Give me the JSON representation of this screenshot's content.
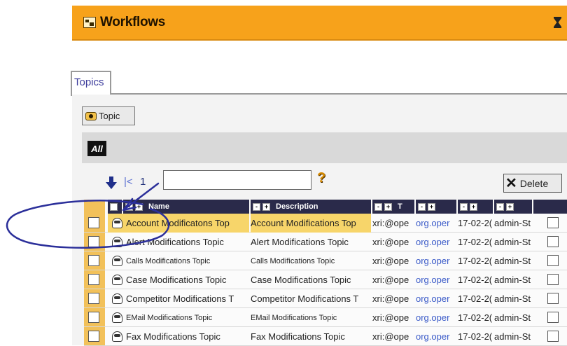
{
  "window": {
    "title": "Workflows",
    "icon": "workflow-icon",
    "status_icon": "hourglass-icon"
  },
  "tabs": [
    {
      "label": "Topics",
      "active": true
    }
  ],
  "toolbar": {
    "topic_button": "Topic",
    "all_button": "All",
    "delete_button": "Delete"
  },
  "pagination": {
    "current_page": "1",
    "input_value": ""
  },
  "columns": [
    {
      "label": "Name"
    },
    {
      "label": "Description"
    },
    {
      "label": "T"
    },
    {
      "label": ""
    },
    {
      "label": ""
    },
    {
      "label": ""
    }
  ],
  "rows": [
    {
      "name": "Account Modificatons Top",
      "description": "Account Modifications Top",
      "col3": "xri:@ope",
      "col4": "org.oper",
      "col5": "17-02-2(",
      "col6": "admin-St"
    },
    {
      "name": "Alert Modifications Topic",
      "description": "Alert Modifications Topic",
      "col3": "xri:@ope",
      "col4": "org.oper",
      "col5": "17-02-2(",
      "col6": "admin-St"
    },
    {
      "name": "Calls Modifications Topic",
      "description": "Calls Modifications Topic",
      "col3": "xri:@ope",
      "col4": "org.oper",
      "col5": "17-02-2(",
      "col6": "admin-St"
    },
    {
      "name": "Case Modifications Topic",
      "description": "Case Modifications Topic",
      "col3": "xri:@ope",
      "col4": "org.oper",
      "col5": "17-02-2(",
      "col6": "admin-St"
    },
    {
      "name": "Competitor Modifications T",
      "description": "Competitor Modifications T",
      "col3": "xri:@ope",
      "col4": "org.oper",
      "col5": "17-02-2(",
      "col6": "admin-St"
    },
    {
      "name": "EMail Modifications Topic",
      "description": "EMail Modifications Topic",
      "col3": "xri:@ope",
      "col4": "org.oper",
      "col5": "17-02-2(",
      "col6": "admin-St"
    },
    {
      "name": "Fax Modifications Topic",
      "description": "Fax Modifications Topic",
      "col3": "xri:@ope",
      "col4": "org.oper",
      "col5": "17-02-2(",
      "col6": "admin-St"
    }
  ],
  "colors": {
    "accent": "#f7a21b",
    "header": "#2a2a4a",
    "annotation": "#2b2f9a"
  }
}
